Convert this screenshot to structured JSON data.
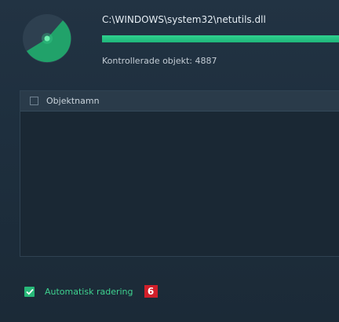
{
  "scan": {
    "current_file": "C:\\WINDOWS\\system32\\netutils.dll",
    "progress_percent": 100,
    "checked_objects": "Kontrollerade objekt: 4887"
  },
  "results": {
    "column_header": "Objektnamn",
    "select_all_checked": false,
    "rows": []
  },
  "options": {
    "auto_delete_label": "Automatisk radering",
    "auto_delete_checked": true
  },
  "annotation": {
    "badge": "6"
  },
  "colors": {
    "accent": "#27b878",
    "background": "#1e2f3e",
    "badge": "#d11f2a"
  },
  "icons": {
    "radar": "radar-scan-icon",
    "check": "checkmark-icon"
  }
}
